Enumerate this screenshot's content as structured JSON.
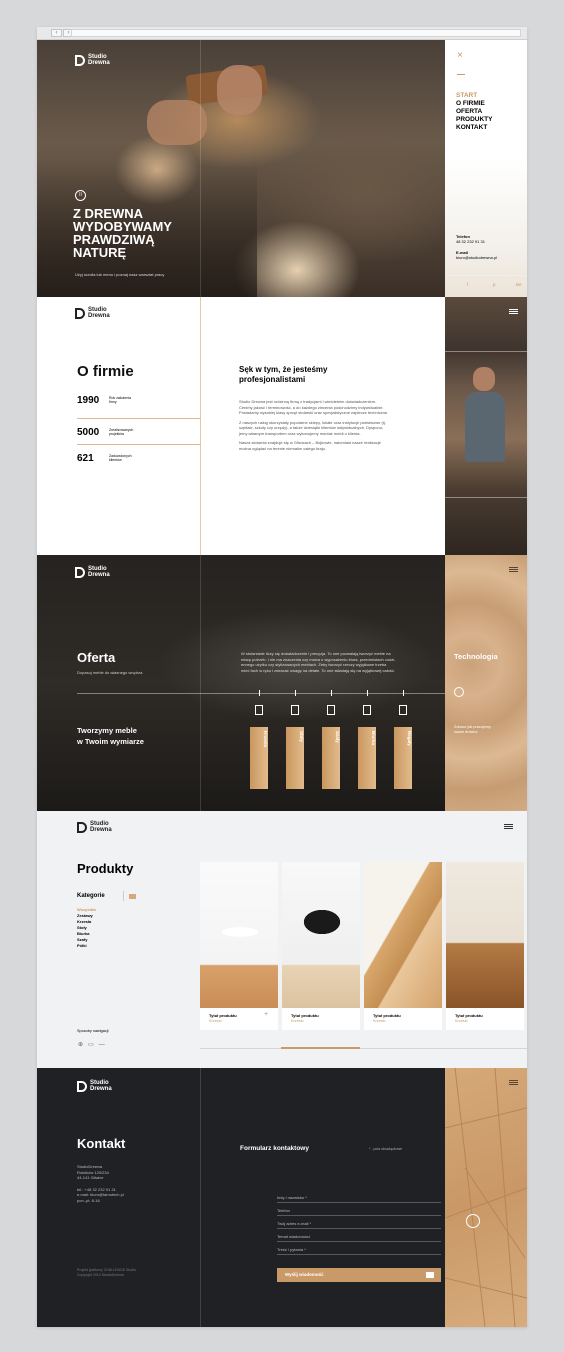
{
  "brand": {
    "name_line1": "Studio",
    "name_line2": "Drewna",
    "tm": "™"
  },
  "hero": {
    "headline_l1": "Z DREWNA",
    "headline_l2": "WYDOBYWAMY",
    "headline_l3": "PRAWDZIWĄ",
    "headline_l4": "NATURĘ",
    "sub": "Użyj scrolla lub menu i poznaj nasz warsztat pracy"
  },
  "nav": {
    "items": [
      "START",
      "O FIRMIE",
      "OFERTA",
      "PRODUKTY",
      "KONTAKT"
    ],
    "phone_label": "Telefon",
    "phone": "48 32 232 91 31",
    "email_label": "E-mail",
    "email": "biuro@studiodrewna.pl",
    "social": [
      "f",
      "p",
      "Be"
    ]
  },
  "about": {
    "title": "O firmie",
    "stats": [
      {
        "value": "1990",
        "label": "Rok założenia firmy"
      },
      {
        "value": "5000",
        "label": "Zrealizowanych projektów"
      },
      {
        "value": "621",
        "label": "Zadowolonych klientów"
      }
    ],
    "heading_l1": "Sęk w tym, że jesteśmy",
    "heading_l2": "profesjonalistami",
    "p1_l1": "Studio Drewna jest rodzinną firmą z tradycjami i wieloletnim doświadczeniem.",
    "p1_l2": "Cenimy jakość i terminowość, a do każdego zlecenia podchodzimy indywidualnie.",
    "p1_l3": "Posiadamy wysokiej klasy sprzęt stolarski oraz specjalistyczne zaplecze techniczne.",
    "p2_l1": "Z naszych usług skorzystały popularne sklepy, lokale oraz instytucje państwowe (tj.",
    "p2_l2": "szpitale, szkoły czy urzędy), a także dziesiątki klientów indywidualnych. Dysponu-",
    "p2_l3": "jemy własnym transportem oraz wykonujemy montaż mebli u klienta.",
    "p3_l1": "Nasza stolarnia znajduje się w Gliwicach – Bojkowie, natomiast nasze realizacje",
    "p3_l2": "można oglądać na terenie niemalże całego kraju."
  },
  "offer": {
    "title": "Oferta",
    "sub": "Dopasuj meble do własnego wnętrza",
    "tag_l1": "Tworzymy meble",
    "tag_l2": "w Twoim wymiarze",
    "p_l1": "W stolarstwie liczy się doświadczenie i precyzja. To one pozwalają tworzyć meble na",
    "p_l2": "miarę potrzeb. I nie ma znaczenia czy mowa o wyposażeniu biura, przedmiotach codzi-",
    "p_l3": "ennego użytku czy stylizowanych meblach. Żeby tworzyć rzeczy wyjątkowe trzeba",
    "p_l4": "mieć fach w ręku i zwracać uwagę na detale. To one składają się na wyjątkowej całość.",
    "categories": [
      "Krzesła",
      "Stoły",
      "Szafy",
      "Biurka",
      "Regały"
    ],
    "tech_title": "Technologia",
    "tech_sub_l1": "Zobacz jak pracujemy",
    "tech_sub_l2": "nasze drewno"
  },
  "products": {
    "title": "Produkty",
    "cat_label": "Kategorie",
    "cats": [
      "Wszystkie",
      "Zestawy",
      "Krzesła",
      "Stoły",
      "Biurka",
      "Szafy",
      "Półki"
    ],
    "nav_hint": "Sposoby nawigacji",
    "cards": [
      {
        "name": "Tytuł produktu",
        "type": "Krzesło"
      },
      {
        "name": "Tytuł produktu",
        "type": "Krzesło"
      },
      {
        "name": "Tytuł produktu",
        "type": "Krzesło"
      },
      {
        "name": "Tytuł produktu",
        "type": "Krzesło"
      }
    ]
  },
  "contact": {
    "title": "Kontakt",
    "addr_l1": "StudioDrewna",
    "addr_l2": "Rolników 120/234",
    "addr_l3": "44-141 Gliwice",
    "tel": "tel.: +48 32 232 91 31",
    "mail": "e-mail: biuro@tamotech.pl",
    "hours": "pon.-pt. 8-16",
    "credit1": "Projekt graficzny CHALLENGE Studio",
    "credit2": "Copyright 2014 StudioDrewna",
    "form_title": "Formularz kontaktowy",
    "required": "* - pola obowiązkowe",
    "fields": [
      "Imię i nazwisko *",
      "Telefon",
      "Twój adres e-mail *",
      "Temat wiadomości",
      "Treść / pytania *"
    ],
    "send": "Wyślij wiadomość"
  },
  "colors": {
    "accent": "#c99a67",
    "dark": "#1f2125"
  }
}
